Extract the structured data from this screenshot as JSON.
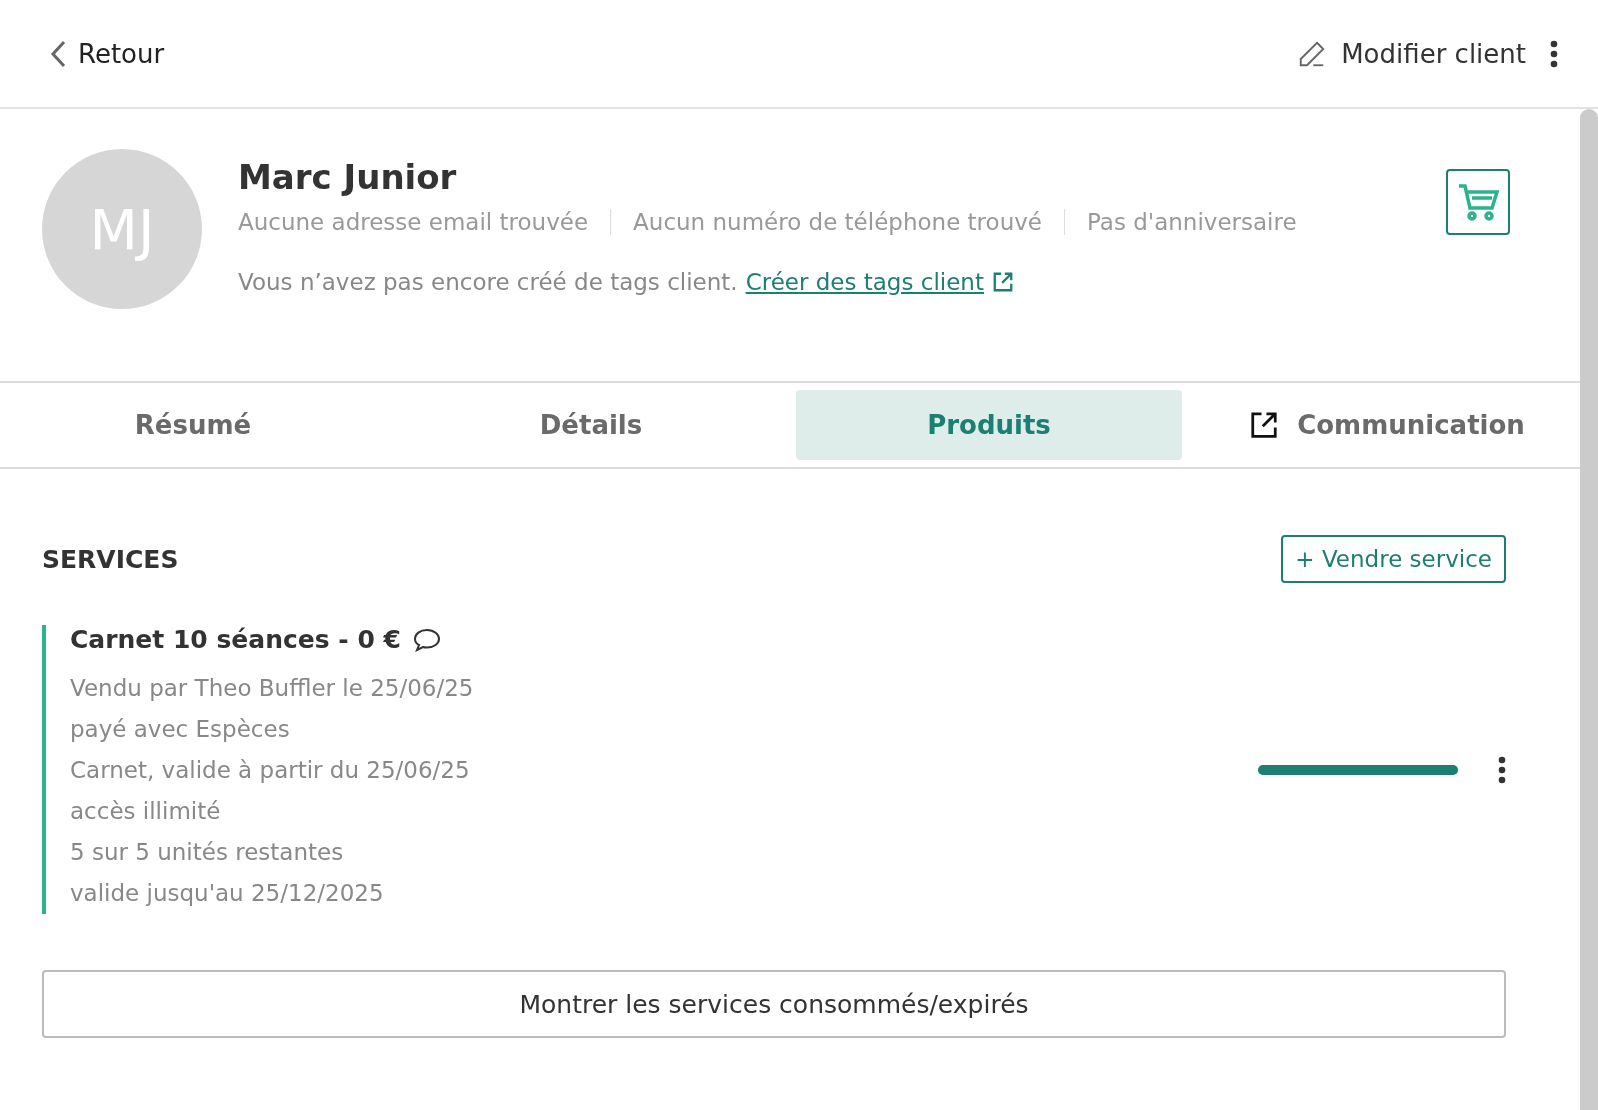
{
  "header": {
    "back": "Retour",
    "edit": "Modifier client"
  },
  "client": {
    "initials": "MJ",
    "name": "Marc Junior",
    "info": [
      "Aucune adresse email trouvée",
      "Aucun numéro de téléphone trouvé",
      "Pas d'anniversaire"
    ],
    "tags_text": "Vous n’avez pas encore créé de tags client.",
    "tags_link": "Créer des tags client"
  },
  "tabs": [
    {
      "label": "Résumé",
      "selected": false,
      "external": false
    },
    {
      "label": "Détails",
      "selected": false,
      "external": false
    },
    {
      "label": "Produits",
      "selected": true,
      "external": false
    },
    {
      "label": "Communication",
      "selected": false,
      "external": true
    }
  ],
  "services": {
    "title": "SERVICES",
    "sell_button": "+ Vendre service",
    "items": [
      {
        "title": "Carnet 10 séances - 0 €",
        "lines": [
          "Vendu par Theo Buffler le 25/06/25",
          "payé avec Espèces",
          "Carnet, valide à partir du 25/06/25",
          "accès illimité",
          "5 sur 5 unités restantes",
          "valide jusqu'au 25/12/2025"
        ],
        "level": 1
      }
    ],
    "show_more": "Montrer les services consommés/expirés"
  }
}
